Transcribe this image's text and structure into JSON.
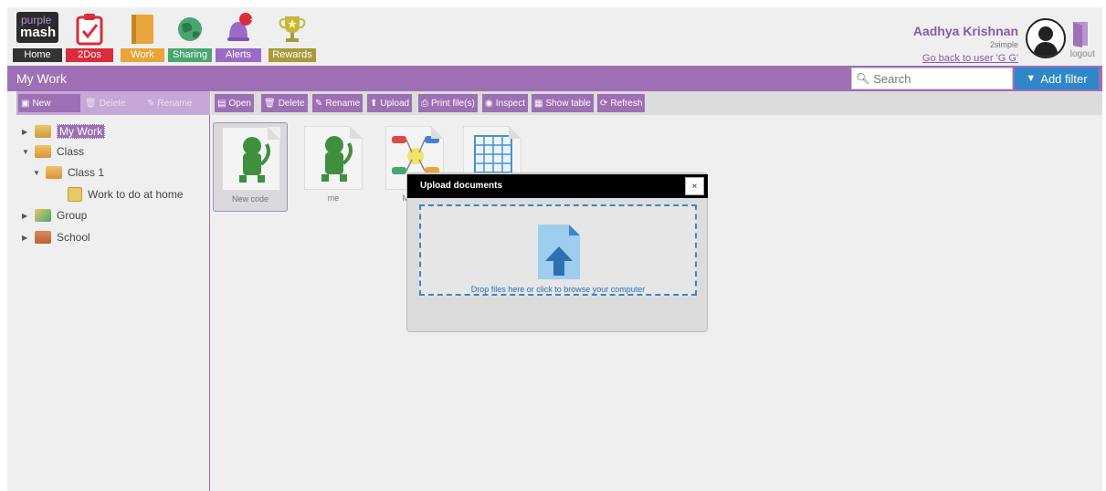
{
  "nav": {
    "logo_top": "purple",
    "logo_bottom": "mash",
    "items": [
      {
        "label": "Home"
      },
      {
        "label": "2Dos"
      },
      {
        "label": "Work"
      },
      {
        "label": "Sharing"
      },
      {
        "label": "Alerts",
        "badge": "1"
      },
      {
        "label": "Rewards"
      }
    ]
  },
  "user": {
    "name": "Aadhya Krishnan",
    "sub": "2simple",
    "back_link": "Go back to user 'G G'",
    "logout": "logout"
  },
  "titlebar": {
    "title": "My Work",
    "search_placeholder": "Search",
    "add_filter": "Add filter"
  },
  "left_toolbar": {
    "new": "New",
    "delete": "Delete",
    "rename": "Rename"
  },
  "right_toolbar": {
    "open": "Open",
    "delete": "Delete",
    "rename": "Rename",
    "upload": "Upload",
    "print": "Print file(s)",
    "inspect": "Inspect",
    "show_table": "Show table",
    "refresh": "Refresh"
  },
  "tree": {
    "my_work": "My Work",
    "class": "Class",
    "class1": "Class 1",
    "work_home": "Work to do at home",
    "group": "Group",
    "school": "School"
  },
  "files": [
    {
      "name": "New code"
    },
    {
      "name": "me"
    },
    {
      "name": "My trip"
    },
    {
      "name": ""
    }
  ],
  "modal": {
    "title": "Upload documents",
    "close": "×",
    "drop_text": "Drop files here or click to browse your computer"
  },
  "colors": {
    "brand_purple": "#9e6fb5",
    "filter_blue": "#2f86c9"
  }
}
